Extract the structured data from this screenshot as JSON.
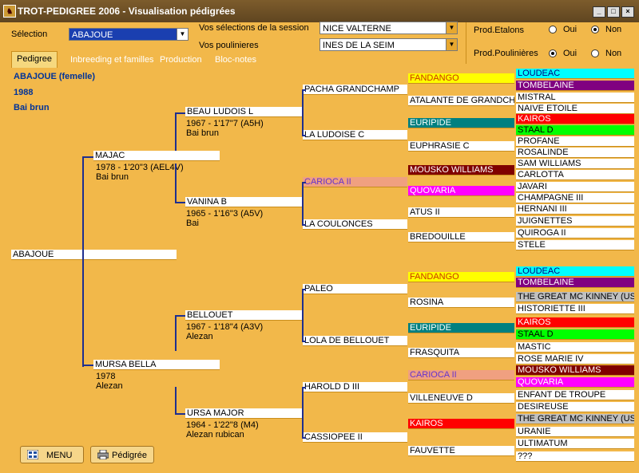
{
  "window": {
    "title": "TROT-PEDIGREE 2006  -  Visualisation pédigrées"
  },
  "header": {
    "selection_label": "Sélection",
    "selection_value": "ABAJOUE",
    "session_label": "Vos sélections de la session",
    "session_value": "NICE VALTERNE",
    "poulinieres_label": "Vos poulinieres",
    "poulinieres_value": "INES DE LA SEIM",
    "prod_etalons": {
      "label": "Prod.Etalons",
      "oui": "Oui",
      "non": "Non",
      "selected": "Non"
    },
    "prod_poulinieres": {
      "label": "Prod.Poulinières",
      "oui": "Oui",
      "non": "Non",
      "selected": "Oui"
    }
  },
  "tabs": [
    {
      "label": "Pedigree",
      "active": true
    },
    {
      "label": "Inbreeding et familles",
      "active": false
    },
    {
      "label": "Production",
      "active": false
    },
    {
      "label": "Bloc-notes",
      "active": false
    }
  ],
  "horse": {
    "name_line": "ABAJOUE  (femelle)",
    "year": "1988",
    "color": "Bai brun"
  },
  "subject": "ABAJOUE",
  "gen1": [
    {
      "name": "MAJAC",
      "record": "1978 -  1'20''3 (AEL4V)",
      "coat": "Bai brun"
    },
    {
      "name": "MURSA BELLA",
      "record": "1978",
      "coat": "Alezan"
    }
  ],
  "gen2": [
    {
      "name": "BEAU LUDOIS L",
      "record": "1967 -  1'17''7 (A5H)",
      "coat": "Bai brun"
    },
    {
      "name": "VANINA B",
      "record": "1965 -  1'16''3 (A5V)",
      "coat": "Bai"
    },
    {
      "name": "BELLOUET",
      "record": "1967 -  1'18''4 (A3V)",
      "coat": "Alezan"
    },
    {
      "name": "URSA MAJOR",
      "record": "1964 -  1'22''8 (M4)",
      "coat": "Alezan rubican"
    }
  ],
  "gen3": [
    {
      "name": "PACHA GRANDCHAMP"
    },
    {
      "name": "LA LUDOISE C"
    },
    {
      "name": "CARIOCA II",
      "bg": "#f0a080",
      "fg": "#6633cc"
    },
    {
      "name": "LA COULONCES"
    },
    {
      "name": "PALEO"
    },
    {
      "name": "LOLA DE BELLOUET"
    },
    {
      "name": "HAROLD D III"
    },
    {
      "name": "CASSIOPEE II"
    }
  ],
  "gen4": [
    {
      "name": "FANDANGO",
      "bg": "#ffff00",
      "fg": "#cc3300"
    },
    {
      "name": "ATALANTE DE GRANDCHAMP",
      "bg": "#ffffff",
      "fg": "#000000"
    },
    {
      "name": "EURIPIDE",
      "bg": "#008080",
      "fg": "#ffffff"
    },
    {
      "name": "EUPHRASIE C",
      "bg": "#ffffff",
      "fg": "#000000"
    },
    {
      "name": "MOUSKO WILLIAMS",
      "bg": "#800000",
      "fg": "#ffffff"
    },
    {
      "name": "QUOVARIA",
      "bg": "#ff00ff",
      "fg": "#ffffff"
    },
    {
      "name": "ATUS II",
      "bg": "#ffffff",
      "fg": "#000000"
    },
    {
      "name": "BREDOUILLE",
      "bg": "#ffffff",
      "fg": "#000000"
    },
    {
      "name": "FANDANGO",
      "bg": "#ffff00",
      "fg": "#cc3300"
    },
    {
      "name": "ROSINA",
      "bg": "#ffffff",
      "fg": "#000000"
    },
    {
      "name": "EURIPIDE",
      "bg": "#008080",
      "fg": "#ffffff"
    },
    {
      "name": "FRASQUITA",
      "bg": "#ffffff",
      "fg": "#000000"
    },
    {
      "name": "CARIOCA II",
      "bg": "#f0a080",
      "fg": "#6633cc"
    },
    {
      "name": "VILLENEUVE D",
      "bg": "#ffffff",
      "fg": "#000000"
    },
    {
      "name": "KAIROS",
      "bg": "#ff0000",
      "fg": "#ffffff"
    },
    {
      "name": "FAUVETTE",
      "bg": "#ffffff",
      "fg": "#000000"
    }
  ],
  "gen5": [
    {
      "name": "LOUDEAC",
      "bg": "#00ffff",
      "fg": "#000080"
    },
    {
      "name": "TOMBELAINE",
      "bg": "#800080",
      "fg": "#ffffff"
    },
    {
      "name": "MISTRAL",
      "bg": "#ffffff",
      "fg": "#000000"
    },
    {
      "name": "NAIVE ETOILE",
      "bg": "#ffffff",
      "fg": "#000000"
    },
    {
      "name": "KAIROS",
      "bg": "#ff0000",
      "fg": "#ffffff"
    },
    {
      "name": "STAAL D",
      "bg": "#00ff00",
      "fg": "#000000"
    },
    {
      "name": "PROFANE",
      "bg": "#ffffff",
      "fg": "#000000"
    },
    {
      "name": "ROSALINDE",
      "bg": "#ffffff",
      "fg": "#000000"
    },
    {
      "name": "SAM WILLIAMS",
      "bg": "#ffffff",
      "fg": "#000000"
    },
    {
      "name": "CARLOTTA",
      "bg": "#ffffff",
      "fg": "#000000"
    },
    {
      "name": "JAVARI",
      "bg": "#ffffff",
      "fg": "#000000"
    },
    {
      "name": "CHAMPAGNE III",
      "bg": "#ffffff",
      "fg": "#000000"
    },
    {
      "name": "HERNANI III",
      "bg": "#ffffff",
      "fg": "#000000"
    },
    {
      "name": "JUIGNETTES",
      "bg": "#ffffff",
      "fg": "#000000"
    },
    {
      "name": "QUIROGA II",
      "bg": "#ffffff",
      "fg": "#000000"
    },
    {
      "name": "STELE",
      "bg": "#ffffff",
      "fg": "#000000"
    },
    {
      "name": "LOUDEAC",
      "bg": "#00ffff",
      "fg": "#000080"
    },
    {
      "name": "TOMBELAINE",
      "bg": "#800080",
      "fg": "#ffffff"
    },
    {
      "name": "THE GREAT MC KINNEY (US)",
      "bg": "#c0c0c0",
      "fg": "#000000"
    },
    {
      "name": "HISTORIETTE III",
      "bg": "#ffffff",
      "fg": "#000000"
    },
    {
      "name": "KAIROS",
      "bg": "#ff0000",
      "fg": "#ffffff"
    },
    {
      "name": "STAAL D",
      "bg": "#00ff00",
      "fg": "#000000"
    },
    {
      "name": "MASTIC",
      "bg": "#ffffff",
      "fg": "#000000"
    },
    {
      "name": "ROSE MARIE IV",
      "bg": "#ffffff",
      "fg": "#000000"
    },
    {
      "name": "MOUSKO WILLIAMS",
      "bg": "#800000",
      "fg": "#ffffff"
    },
    {
      "name": "QUOVARIA",
      "bg": "#ff00ff",
      "fg": "#ffffff"
    },
    {
      "name": "ENFANT DE TROUPE",
      "bg": "#ffffff",
      "fg": "#000000"
    },
    {
      "name": "DESIREUSE",
      "bg": "#ffffff",
      "fg": "#000000"
    },
    {
      "name": "THE GREAT MC KINNEY (US)",
      "bg": "#c0c0c0",
      "fg": "#000000"
    },
    {
      "name": "URANIE",
      "bg": "#ffffff",
      "fg": "#000000"
    },
    {
      "name": "ULTIMATUM",
      "bg": "#ffffff",
      "fg": "#000000"
    },
    {
      "name": "???",
      "bg": "#ffffff",
      "fg": "#000000"
    }
  ],
  "buttons": {
    "menu": "MENU",
    "pedigree": "Pédigrée"
  },
  "icons": {
    "menu": "menu-grid-icon",
    "print": "printer-icon",
    "app": "horse-app-icon"
  }
}
